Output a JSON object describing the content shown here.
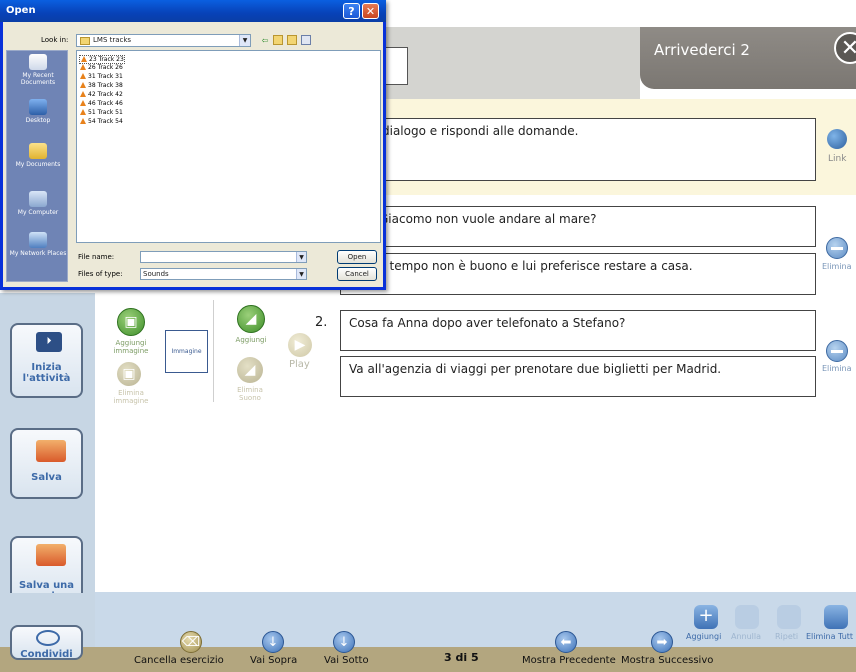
{
  "app": {
    "title": "Arrivederci 2",
    "close_glyph": "✕",
    "instruction": "dialogo e rispondi alle domande.",
    "link_label": "Link",
    "questions": [
      {
        "number": "",
        "question": "Giacomo non vuole andare al mare?",
        "answer": "il tempo non è buono e lui preferisce restare a casa.",
        "remove_label": "Elimina"
      },
      {
        "number": "2.",
        "question": "Cosa fa Anna dopo aver telefonato a Stefano?",
        "answer": "Va all'agenzia di viaggi per prenotare due biglietti per Madrid.",
        "remove_label": "Elimina"
      }
    ],
    "media": {
      "add_image": "Aggiungi immagine",
      "image_placeholder": "Immagine",
      "remove_image": "Elimina immagine",
      "add_sound": "Aggiungi",
      "remove_sound": "Elimina Suono",
      "play": "Play"
    },
    "sidebar": {
      "start": "Inizia l'attività",
      "save": "Salva",
      "save_copy": "Salva una copia",
      "share": "Condividi"
    },
    "toolbar": {
      "add": "Aggiungi",
      "undo": "Annulla",
      "redo": "Ripeti",
      "delete_all": "Elimina Tutt"
    },
    "bottom": {
      "clear": "Cancella esercizio",
      "move_up": "Vai Sopra",
      "move_down": "Vai Sotto",
      "page": "3 di 5",
      "prev": "Mostra Precedente",
      "next": "Mostra Successivo"
    }
  },
  "dialog": {
    "title": "Open",
    "help_glyph": "?",
    "close_glyph": "✕",
    "look_in_label": "Look in:",
    "look_in_value": "LMS tracks",
    "places": [
      "My Recent Documents",
      "Desktop",
      "My Documents",
      "My Computer",
      "My Network Places"
    ],
    "files": [
      "23 Track 23",
      "26 Track 26",
      "31 Track 31",
      "38 Track 38",
      "42 Track 42",
      "46 Track 46",
      "51 Track 51",
      "54 Track 54"
    ],
    "file_name_label": "File name:",
    "file_name_value": "",
    "files_of_type_label": "Files of type:",
    "files_of_type_value": "Sounds",
    "open_button": "Open",
    "cancel_button": "Cancel"
  }
}
